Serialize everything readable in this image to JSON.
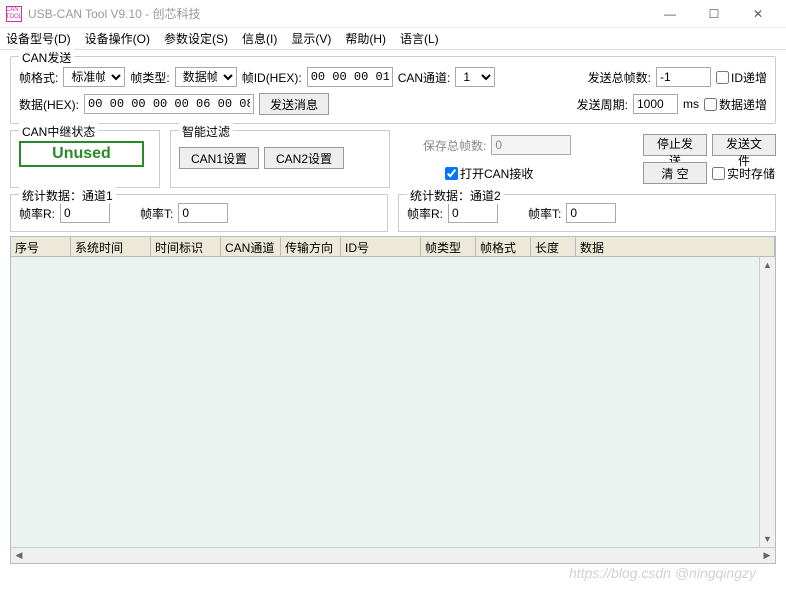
{
  "window": {
    "title": "USB-CAN Tool V9.10 - 创芯科技"
  },
  "menu": {
    "device_model": "设备型号(D)",
    "device_op": "设备操作(O)",
    "param": "参数设定(S)",
    "info": "信息(I)",
    "display": "显示(V)",
    "help": "帮助(H)",
    "lang": "语言(L)"
  },
  "send": {
    "legend": "CAN发送",
    "frame_fmt_lbl": "帧格式:",
    "frame_fmt_val": "标准帧",
    "frame_type_lbl": "帧类型:",
    "frame_type_val": "数据帧",
    "frame_id_lbl": "帧ID(HEX):",
    "frame_id_val": "00 00 00 01",
    "can_ch_lbl": "CAN通道:",
    "can_ch_val": "1",
    "total_lbl": "发送总帧数:",
    "total_val": "-1",
    "id_inc": "ID递增",
    "data_lbl": "数据(HEX):",
    "data_val": "00 00 00 00 00 06 00 08",
    "send_btn": "发送消息",
    "period_lbl": "发送周期:",
    "period_val": "1000",
    "period_unit": "ms",
    "data_inc": "数据递增"
  },
  "relay": {
    "legend": "CAN中继状态",
    "status": "Unused"
  },
  "filter": {
    "legend": "智能过滤",
    "can1_btn": "CAN1设置",
    "can2_btn": "CAN2设置"
  },
  "recv": {
    "save_lbl": "保存总帧数:",
    "save_val": "0",
    "open_recv": "打开CAN接收",
    "open_recv_checked": true,
    "stop_btn": "停止发送",
    "send_file_btn": "发送文件",
    "clear_btn": "清 空",
    "rt_save": "实时存储"
  },
  "stats": {
    "leg1": "统计数据：通道1",
    "leg2": "统计数据：通道2",
    "r_lbl": "帧率R:",
    "t_lbl": "帧率T:",
    "r1": "0",
    "t1": "0",
    "r2": "0",
    "t2": "0"
  },
  "table": {
    "cols": [
      "序号",
      "系统时间",
      "时间标识",
      "CAN通道",
      "传输方向",
      "ID号",
      "帧类型",
      "帧格式",
      "长度",
      "数据"
    ]
  },
  "watermark": "https://blog.csdn @ningqingzy"
}
